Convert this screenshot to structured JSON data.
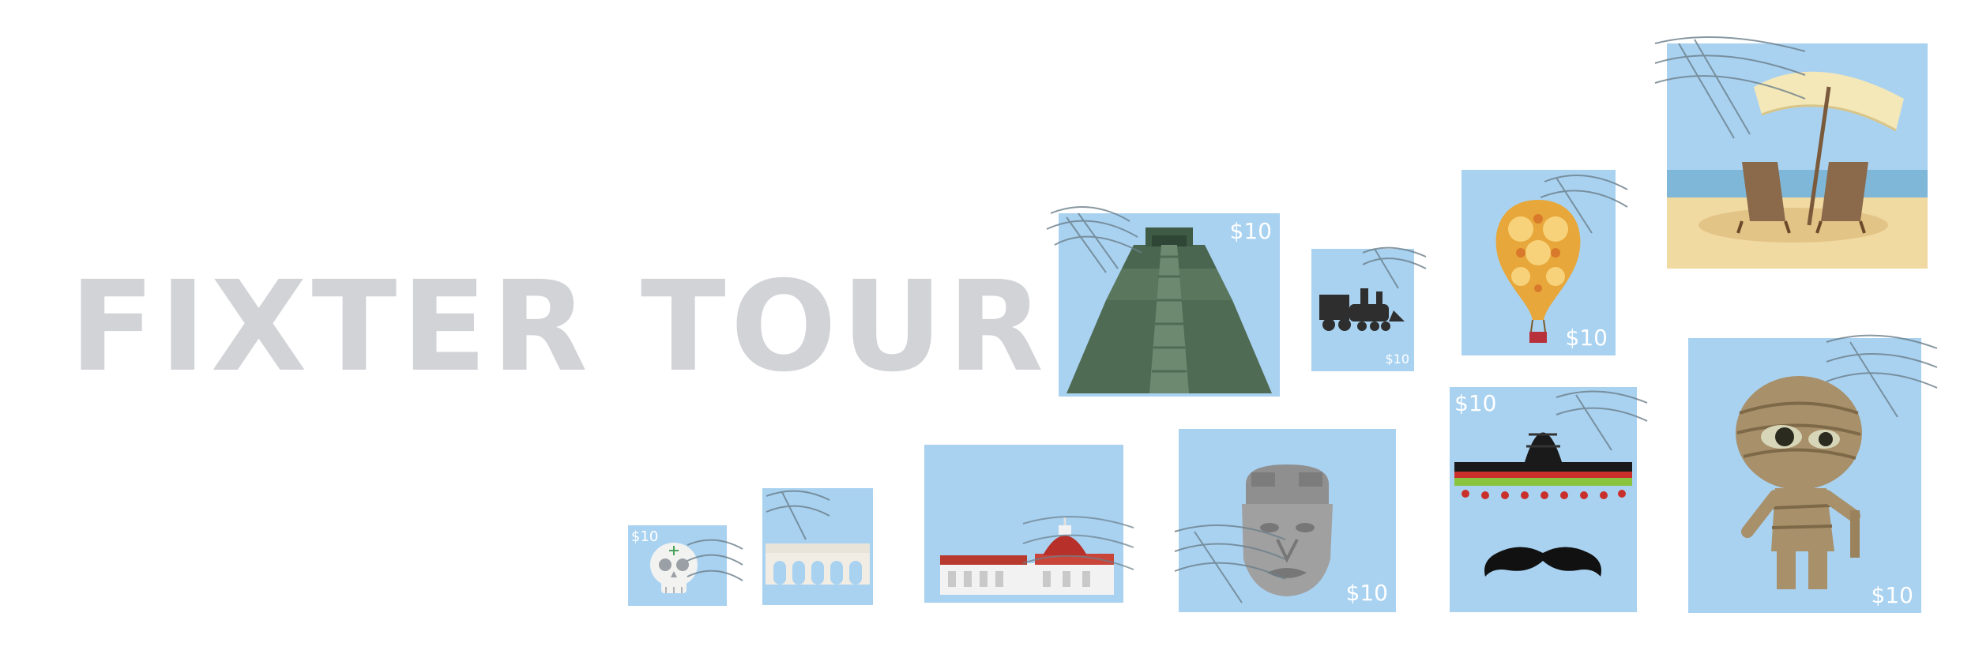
{
  "brand": {
    "title": "FIXTER TOUR"
  },
  "colors": {
    "stamp_bg": "#a9d2f1",
    "title": "#d2d3d7",
    "price": "#ffffff"
  },
  "stamps": [
    {
      "icon": "pyramid-icon",
      "price": "$10"
    },
    {
      "icon": "train-icon",
      "price": "$10"
    },
    {
      "icon": "hot-air-balloon-icon",
      "price": "$10"
    },
    {
      "icon": "beach-umbrella-icon",
      "price": ""
    },
    {
      "icon": "skull-icon",
      "price": "$10"
    },
    {
      "icon": "aqueduct-icon",
      "price": ""
    },
    {
      "icon": "cathedral-icon",
      "price": ""
    },
    {
      "icon": "olmec-head-icon",
      "price": "$10"
    },
    {
      "icon": "sombrero-mustache-icon",
      "price": "$10"
    },
    {
      "icon": "mummy-icon",
      "price": "$10"
    }
  ]
}
